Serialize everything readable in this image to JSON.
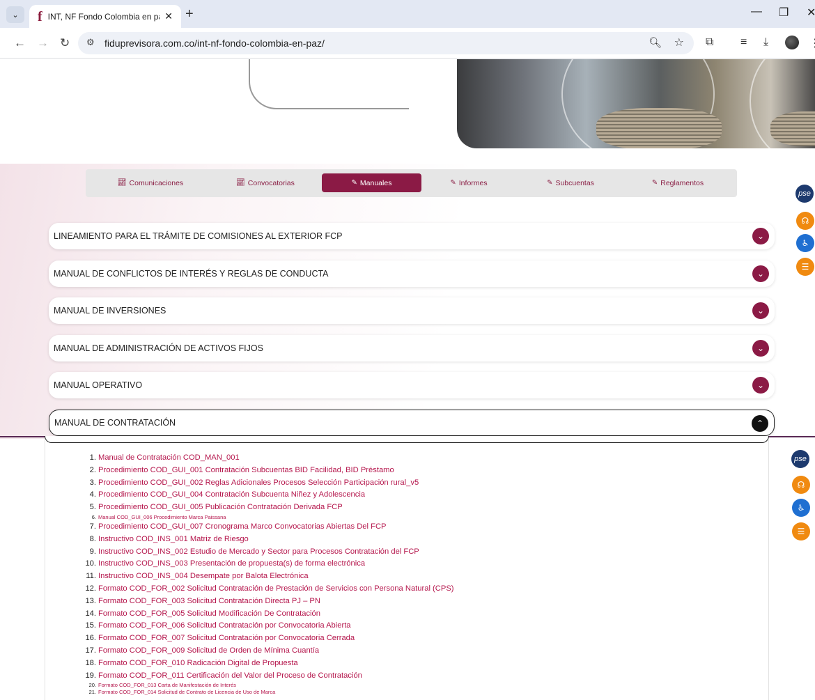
{
  "browser": {
    "tab_title": "INT, NF Fondo Colombia en paz",
    "url": "fiduprevisora.com.co/int-nf-fondo-colombia-en-paz/"
  },
  "tabs": [
    {
      "label": "Comunicaciones",
      "icon": "chart-icon",
      "active": false
    },
    {
      "label": "Convocatorias",
      "icon": "chart-icon",
      "active": false
    },
    {
      "label": "Manuales",
      "icon": "edit-icon",
      "active": true
    },
    {
      "label": "Informes",
      "icon": "edit-icon",
      "active": false
    },
    {
      "label": "Subcuentas",
      "icon": "edit-icon",
      "active": false
    },
    {
      "label": "Reglamentos",
      "icon": "edit-icon",
      "active": false
    }
  ],
  "accordion": [
    {
      "title": "LINEAMIENTO PARA EL TRÁMITE DE COMISIONES AL EXTERIOR FCP",
      "open": false
    },
    {
      "title": "MANUAL DE CONFLICTOS DE INTERÉS Y REGLAS DE CONDUCTA",
      "open": false
    },
    {
      "title": "MANUAL DE INVERSIONES",
      "open": false
    },
    {
      "title": "MANUAL DE ADMINISTRACIÓN DE ACTIVOS FIJOS",
      "open": false
    },
    {
      "title": "MANUAL OPERATIVO",
      "open": false
    },
    {
      "title": "MANUAL DE CONTRATACIÓN",
      "open": true
    }
  ],
  "documents": [
    {
      "n": "1.",
      "label": "Manual de Contratación COD_MAN_001"
    },
    {
      "n": "2.",
      "label": "Procedimiento COD_GUI_001 Contratación Subcuentas BID Facilidad, BID Préstamo"
    },
    {
      "n": "3.",
      "label": "Procedimiento COD_GUI_002 Reglas Adicionales Procesos Selección Participación rural_v5"
    },
    {
      "n": "4.",
      "label": "Procedimiento COD_GUI_004 Contratación Subcuenta Niñez y Adolescencia"
    },
    {
      "n": "5.",
      "label": "Procedimiento COD_GUI_005 Publicación Contratación Derivada FCP"
    },
    {
      "n": "6.",
      "label": "Manual COD_GUI_006 Procedimiento Marca Paissana",
      "small": true
    },
    {
      "n": "7.",
      "label": "Procedimiento COD_GUI_007 Cronograma Marco Convocatorias Abiertas Del FCP"
    },
    {
      "n": "8.",
      "label": "Instructivo COD_INS_001 Matriz de Riesgo"
    },
    {
      "n": "9.",
      "label": "Instructivo COD_INS_002 Estudio de Mercado y Sector para Procesos Contratación del FCP"
    },
    {
      "n": "10.",
      "label": "Instructivo COD_INS_003 Presentación de propuesta(s) de forma electrónica"
    },
    {
      "n": "11.",
      "label": "Instructivo COD_INS_004 Desempate por Balota Electrónica"
    },
    {
      "n": "12.",
      "label": "Formato COD_FOR_002 Solicitud Contratación de Prestación de Servicios con Persona Natural (CPS)"
    },
    {
      "n": "13.",
      "label": "Formato COD_FOR_003 Solicitud Contratación Directa PJ – PN"
    },
    {
      "n": "14.",
      "label": "Formato COD_FOR_005 Solicitud Modificación De Contratación"
    },
    {
      "n": "15.",
      "label": "Formato COD_FOR_006 Solicitud Contratación por Convocatoria Abierta"
    },
    {
      "n": "16.",
      "label": "Formato COD_FOR_007 Solicitud Contratación por Convocatoria Cerrada"
    },
    {
      "n": "17.",
      "label": "Formato COD_FOR_009 Solicitud de Orden de Mínima Cuantía"
    },
    {
      "n": "18.",
      "label": "Formato COD_FOR_010 Radicación Digital de Propuesta"
    },
    {
      "n": "19.",
      "label": "Formato COD_FOR_011 Certificación del Valor del Proceso de Contratación"
    },
    {
      "n": "20.",
      "label": "Formato COD_FOR_013 Carta de Manifestación de Interés",
      "small": true
    },
    {
      "n": "21.",
      "label": "Formato COD_FOR_014 Solicitud de Contrato de Licencia de Uso de Marca",
      "small": true
    }
  ],
  "floating": {
    "pse": "pse"
  },
  "colors": {
    "brand": "#8b1a45",
    "link": "#b5164c"
  }
}
